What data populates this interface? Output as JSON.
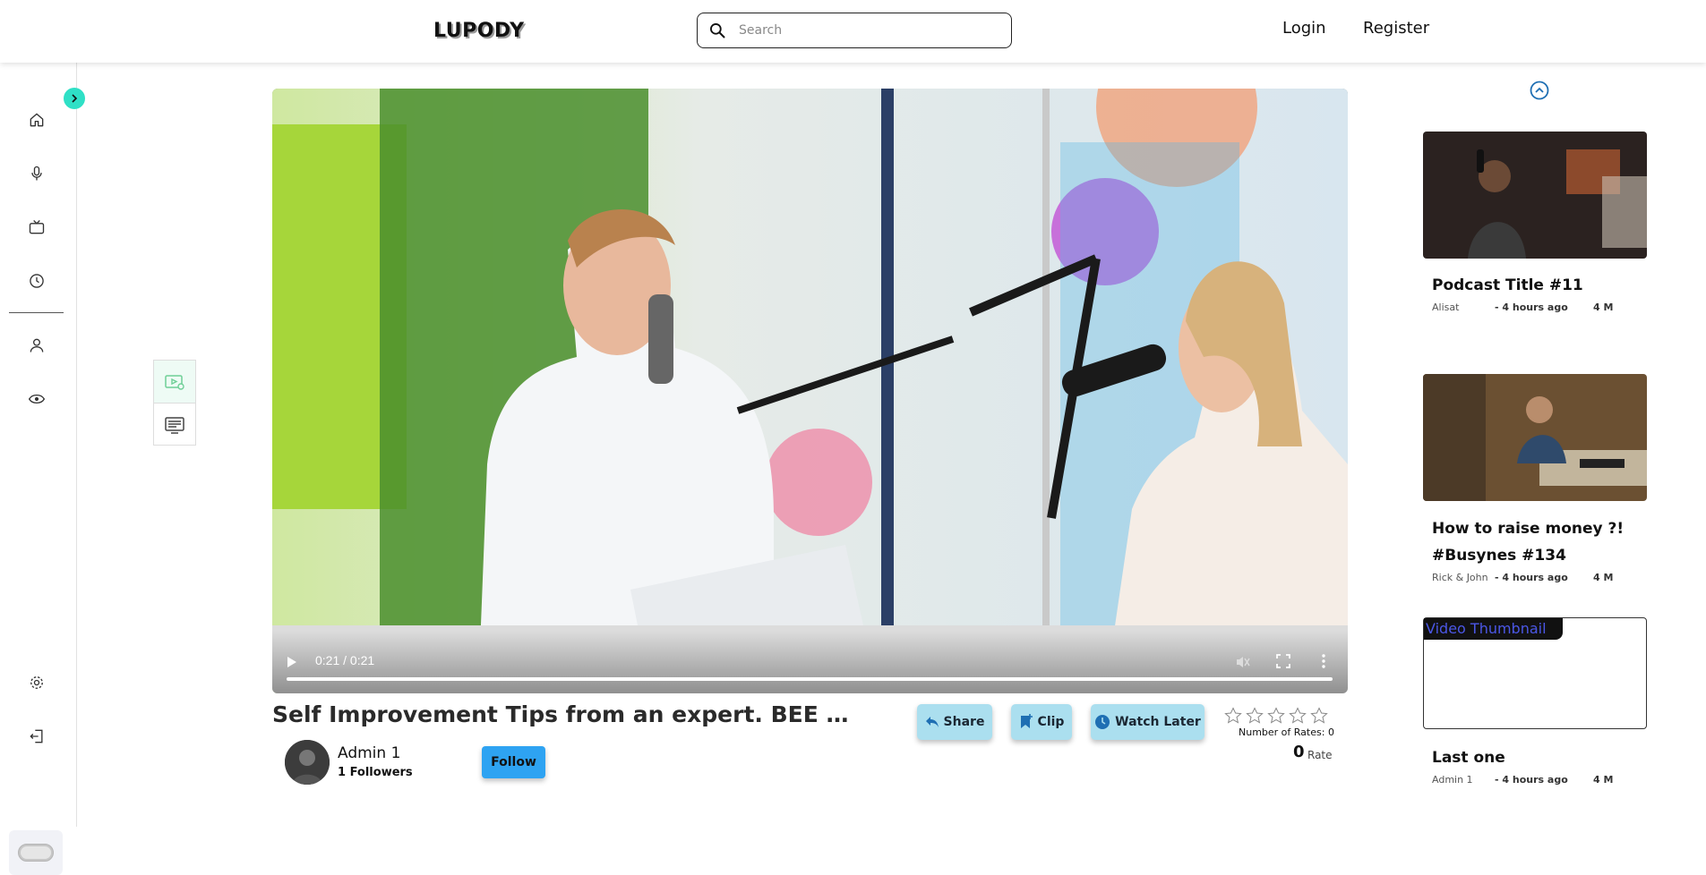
{
  "header": {
    "logo": "LUPODY",
    "search_placeholder": "Search",
    "login": "Login",
    "register": "Register"
  },
  "sidebar": {
    "items": [
      "home-icon",
      "microphone-icon",
      "tv-icon",
      "history-icon",
      "user-icon",
      "eye-icon"
    ],
    "bottom": [
      "settings-icon",
      "logout-icon",
      "theme-toggle"
    ]
  },
  "player": {
    "time": "0:21 / 0:21",
    "progress": 1.0
  },
  "video": {
    "title": "Self Improvement Tips from an expert. BEE PODCAST...",
    "author": "Admin 1",
    "followers": "1 Followers",
    "follow": "Follow",
    "actions": {
      "share": "Share",
      "clip": "Clip",
      "watch_later": "Watch Later"
    },
    "rates_label": "Number of Rates: 0",
    "rate_value": "0",
    "rate_word": "Rate",
    "stars": 0
  },
  "recommended": [
    {
      "title": "Podcast Title #11",
      "author": "Alisat",
      "time": "- 4 hours ago",
      "views": "4 M"
    },
    {
      "title": "How to raise money ?! #Busynes #134",
      "author": "Rick & John",
      "time": "- 4 hours ago",
      "views": "4 M"
    },
    {
      "title": "Last one",
      "author": "Admin 1",
      "time": "- 4 hours ago",
      "views": "4 M",
      "thumb_alt": "Video Thumbnail"
    }
  ],
  "colors": {
    "accent_teal": "#2fe0c6",
    "follow_blue": "#2ea3f2",
    "action_blue": "#abdfef"
  }
}
